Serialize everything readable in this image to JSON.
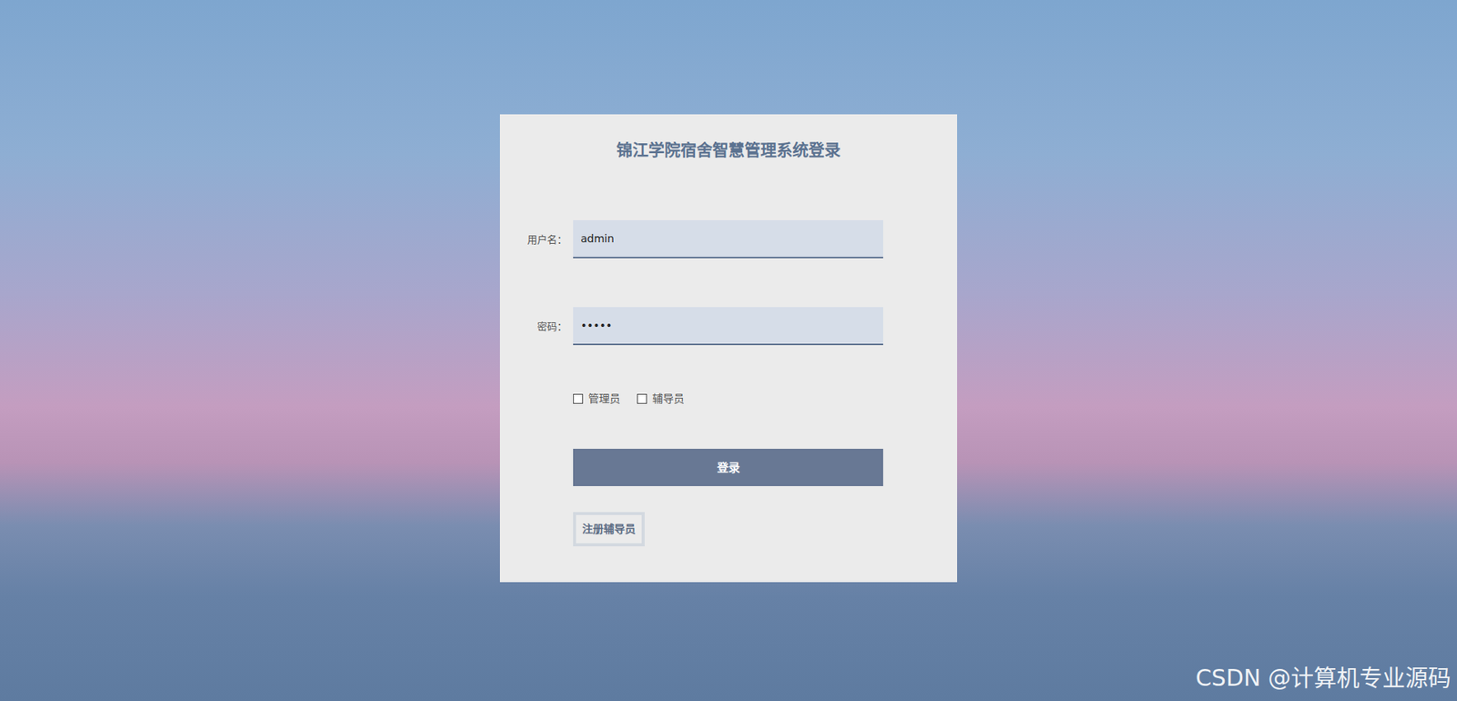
{
  "title": "锦江学院宿舍智慧管理系统登录",
  "fields": [
    {
      "label": "用户名：",
      "value": "admin"
    },
    {
      "label": "密码：",
      "value": "•••••"
    }
  ],
  "roles": [
    {
      "label": "管理员",
      "checked": false
    },
    {
      "label": "辅导员",
      "checked": false
    }
  ],
  "login_button": "登录",
  "register_button": "注册辅导员",
  "watermark": "CSDN @计算机专业源码"
}
